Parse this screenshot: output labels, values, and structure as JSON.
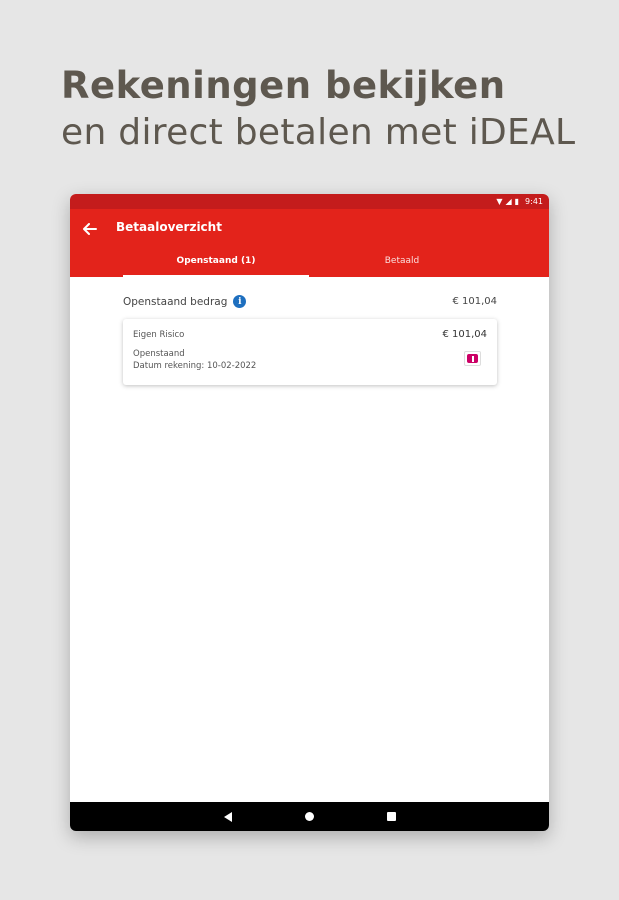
{
  "headline": {
    "line1": "Rekeningen bekijken",
    "line2": "en direct betalen met iDEAL"
  },
  "statusbar": {
    "time": "9:41",
    "icons": [
      "wifi-icon",
      "signal-icon",
      "battery-icon"
    ]
  },
  "appbar": {
    "back_icon": "arrow-left-icon",
    "title": "Betaaloverzicht",
    "tabs": [
      {
        "label": "Openstaand (1)",
        "active": true
      },
      {
        "label": "Betaald",
        "active": false
      }
    ]
  },
  "summary": {
    "label": "Openstaand bedrag",
    "amount": "€ 101,04",
    "info_icon": "info-icon"
  },
  "invoices": [
    {
      "description": "Eigen Risico",
      "amount": "€ 101,04",
      "status": "Openstaand",
      "date": "Datum rekening: 10-02-2022",
      "payment_icon": "ideal-icon"
    }
  ],
  "colors": {
    "brand_red": "#e3231b",
    "status_red": "#c41c1c",
    "info_blue": "#1e6fbf",
    "ideal_pink": "#cc0066"
  }
}
